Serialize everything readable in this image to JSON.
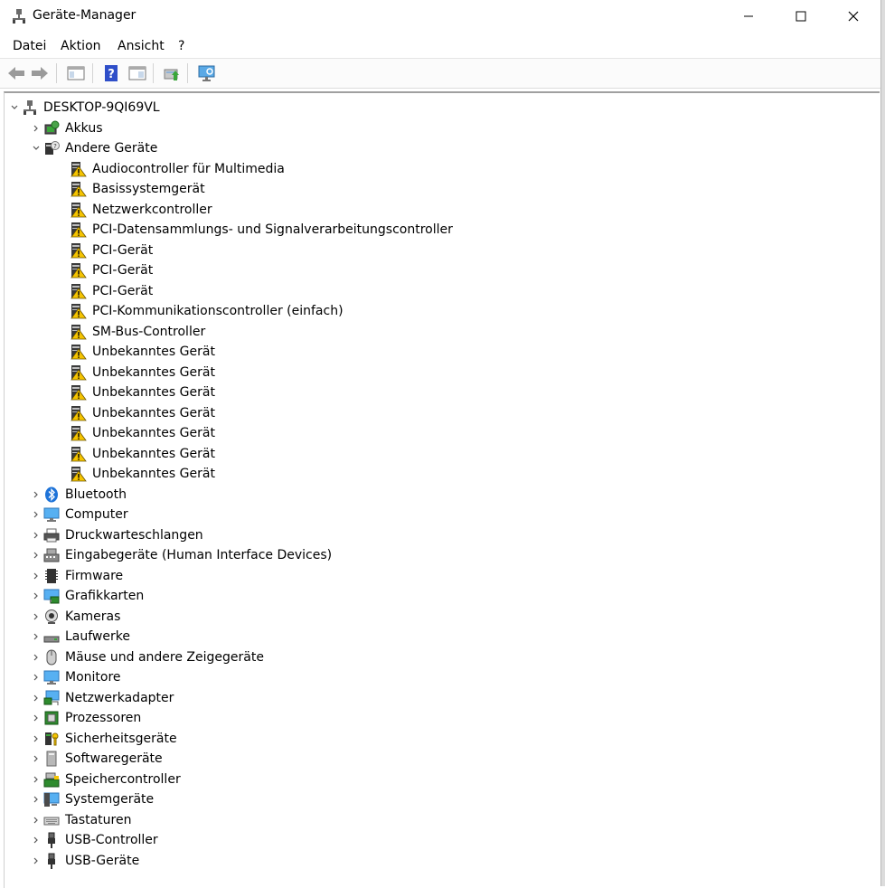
{
  "title": "Geräte-Manager",
  "menu": [
    "Datei",
    "Aktion",
    "Ansicht",
    "?"
  ],
  "colors": {
    "warning": "#f5c400",
    "accent": "#1e73d8",
    "toolbar_blue": "#3b5bdb"
  },
  "tree": {
    "root": {
      "label": "DESKTOP-9QI69VL",
      "icon": "computer-icon"
    },
    "akkus": {
      "label": "Akkus",
      "icon": "battery-icon"
    },
    "andere": {
      "label": "Andere Geräte",
      "icon": "unknown-device-icon",
      "children": [
        "Audiocontroller für Multimedia",
        "Basissystemgerät",
        "Netzwerkcontroller",
        "PCI-Datensammlungs- und Signalverarbeitungscontroller",
        "PCI-Gerät",
        "PCI-Gerät",
        "PCI-Gerät",
        "PCI-Kommunikationscontroller (einfach)",
        "SM-Bus-Controller",
        "Unbekanntes Gerät",
        "Unbekanntes Gerät",
        "Unbekanntes Gerät",
        "Unbekanntes Gerät",
        "Unbekanntes Gerät",
        "Unbekanntes Gerät",
        "Unbekanntes Gerät"
      ]
    },
    "categories": [
      {
        "label": "Bluetooth",
        "icon": "bluetooth-icon"
      },
      {
        "label": "Computer",
        "icon": "monitor-icon"
      },
      {
        "label": "Druckwarteschlangen",
        "icon": "printer-icon"
      },
      {
        "label": "Eingabegeräte (Human Interface Devices)",
        "icon": "hid-icon"
      },
      {
        "label": "Firmware",
        "icon": "chip-icon"
      },
      {
        "label": "Grafikkarten",
        "icon": "display-adapter-icon"
      },
      {
        "label": "Kameras",
        "icon": "camera-icon"
      },
      {
        "label": "Laufwerke",
        "icon": "drive-icon"
      },
      {
        "label": "Mäuse und andere Zeigegeräte",
        "icon": "mouse-icon"
      },
      {
        "label": "Monitore",
        "icon": "monitor-icon"
      },
      {
        "label": "Netzwerkadapter",
        "icon": "network-icon"
      },
      {
        "label": "Prozessoren",
        "icon": "processor-icon"
      },
      {
        "label": "Sicherheitsgeräte",
        "icon": "security-key-icon"
      },
      {
        "label": "Softwaregeräte",
        "icon": "software-device-icon"
      },
      {
        "label": "Speichercontroller",
        "icon": "storage-controller-icon"
      },
      {
        "label": "Systemgeräte",
        "icon": "system-device-icon"
      },
      {
        "label": "Tastaturen",
        "icon": "keyboard-icon"
      },
      {
        "label": "USB-Controller",
        "icon": "usb-icon"
      },
      {
        "label": "USB-Geräte",
        "icon": "usb-icon"
      }
    ]
  }
}
